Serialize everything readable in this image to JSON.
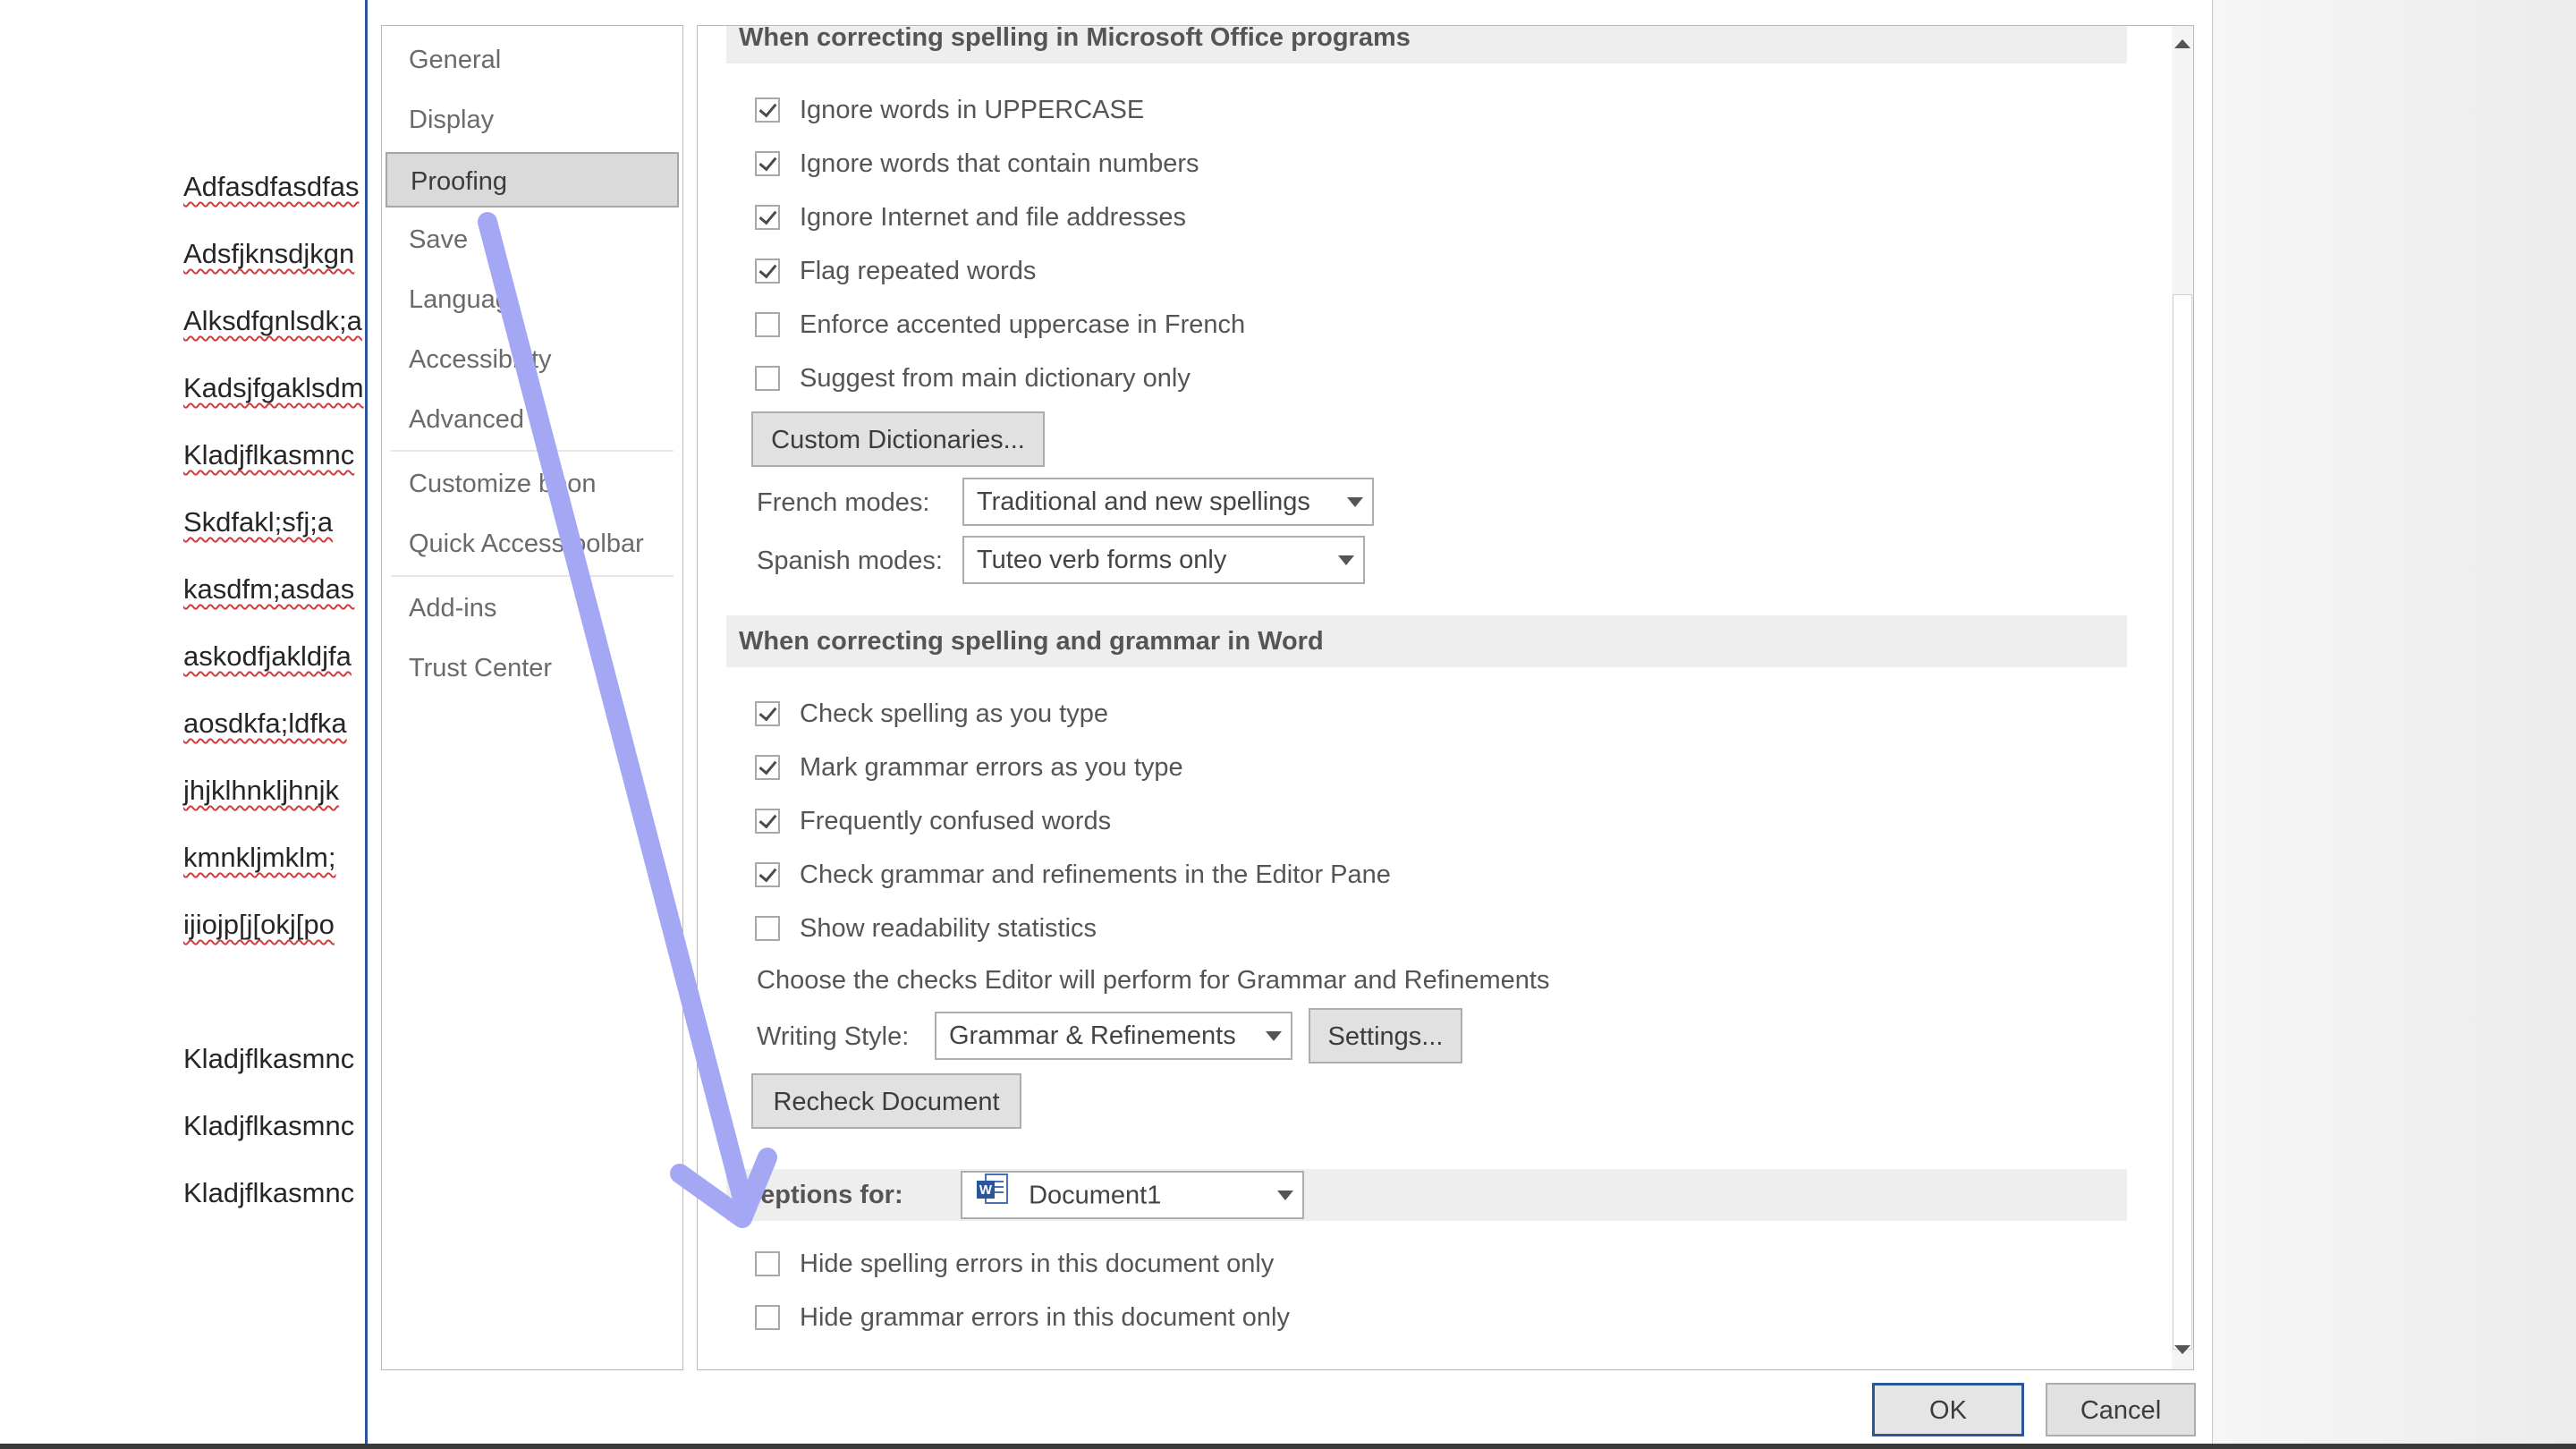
{
  "document": {
    "lines": [
      "Adfasdfasdfas",
      "Adsfjknsdjkgn",
      "Alksdfgnlsdk;a",
      "Kadsjfgaklsdm",
      "Kladjflkasmnc",
      "Skdfakl;sfj;a",
      "kasdfm;asdas",
      "askodfjakldjfa",
      "aosdkfa;ldfka",
      "jhjklhnkljhnjk",
      "kmnkljmklm;",
      "ijiojp[j[okj[po",
      "Kladjflkasmnc",
      "Kladjflkasmnc",
      "Kladjflkasmnc"
    ]
  },
  "nav": {
    "items": [
      {
        "label": "General"
      },
      {
        "label": "Display"
      },
      {
        "label": "Proofing",
        "selected": true
      },
      {
        "label": "Save"
      },
      {
        "label": "Languag"
      },
      {
        "label": "Accessibi  ity"
      },
      {
        "label": "Advanced"
      },
      {
        "label": "Customize  bbon"
      },
      {
        "label": "Quick Access  oolbar"
      },
      {
        "label": "Add-ins"
      },
      {
        "label": "Trust Center"
      }
    ]
  },
  "office_section": {
    "header": "When correcting spelling in Microsoft Office programs",
    "checkboxes": [
      {
        "label": "Ignore words in UPPERCASE",
        "checked": true
      },
      {
        "label": "Ignore words that contain numbers",
        "checked": true
      },
      {
        "label": "Ignore Internet and file addresses",
        "checked": true
      },
      {
        "label": "Flag repeated words",
        "checked": true
      },
      {
        "label": "Enforce accented uppercase in French",
        "checked": false
      },
      {
        "label": "Suggest from main dictionary only",
        "checked": false
      }
    ],
    "custom_dictionaries_label": "Custom Dictionaries...",
    "french_modes_label": "French modes:",
    "french_modes_value": "Traditional and new spellings",
    "spanish_modes_label": "Spanish modes:",
    "spanish_modes_value": "Tuteo verb forms only"
  },
  "word_section": {
    "header": "When correcting spelling and grammar in Word",
    "checkboxes": [
      {
        "label": "Check spelling as you type",
        "checked": true
      },
      {
        "label": "Mark grammar errors as you type",
        "checked": true
      },
      {
        "label": "Frequently confused words",
        "checked": true
      },
      {
        "label": "Check grammar and refinements in the Editor Pane",
        "checked": true
      },
      {
        "label": "Show readability statistics",
        "checked": false
      }
    ],
    "choose_checks_text": "Choose the checks Editor will perform for Grammar and Refinements",
    "writing_style_label": "Writing Style:",
    "writing_style_value": "Grammar & Refinements",
    "settings_label": "Settings...",
    "recheck_label": "Recheck Document"
  },
  "exceptions_section": {
    "label": "ceptions for:",
    "document_value": "Document1",
    "checkboxes": [
      {
        "label": "Hide spelling errors in this document only",
        "checked": false
      },
      {
        "label": "Hide grammar errors in this document only",
        "checked": false
      }
    ]
  },
  "footer": {
    "ok_label": "OK",
    "cancel_label": "Cancel"
  },
  "colors": {
    "accent": "#2b579a",
    "annotation_arrow": "#a4a8f4",
    "spell_underline": "#d23c3c"
  },
  "icons": [
    "word-document-icon",
    "scroll-up-arrow-icon",
    "scroll-down-arrow-icon",
    "chevron-down-icon",
    "checkmark-icon"
  ]
}
